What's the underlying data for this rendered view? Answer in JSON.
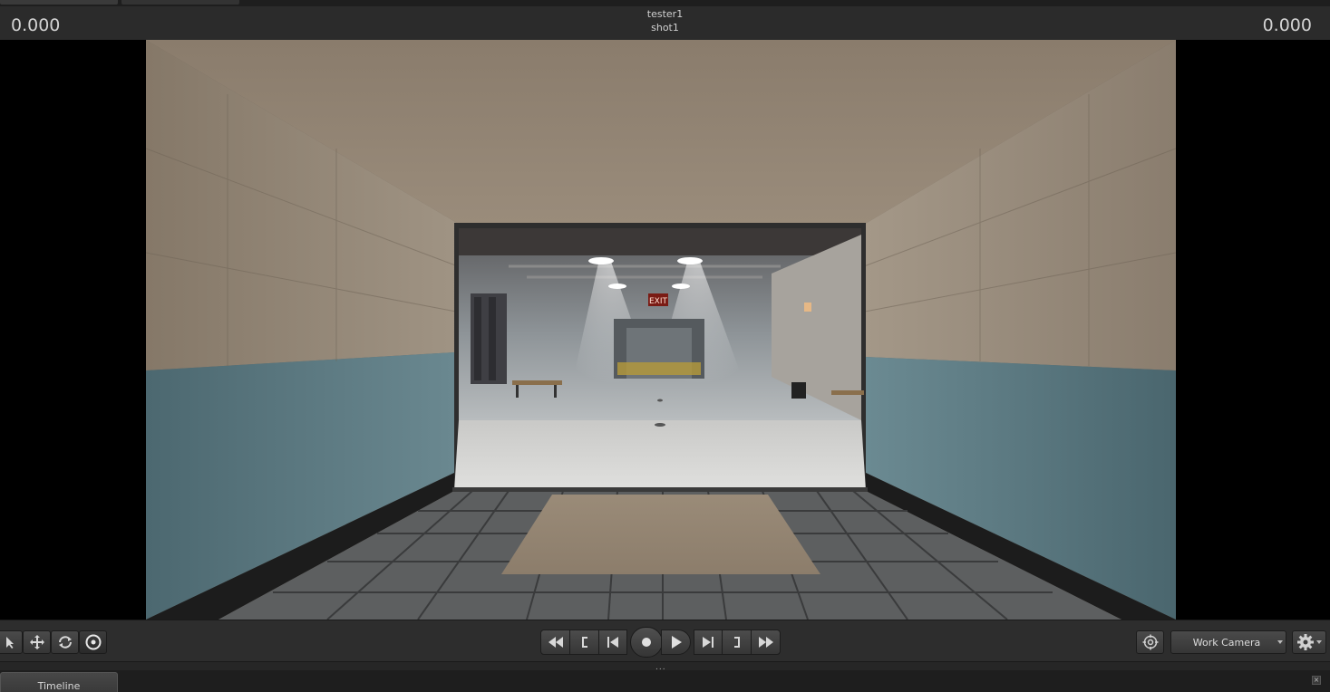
{
  "header": {
    "time_left": "0.000",
    "time_right": "0.000",
    "session_name": "tester1",
    "shot_name": "shot1"
  },
  "viewport": {
    "exit_sign": "EXIT"
  },
  "tools": [
    {
      "icon": "select-arrow-icon"
    },
    {
      "icon": "move-icon"
    },
    {
      "icon": "rotate-icon"
    },
    {
      "icon": "orbit-target-icon",
      "active": true
    }
  ],
  "transport": {
    "buttons": [
      "rewind-icon",
      "mark-in-icon",
      "skip-start-icon",
      "record-icon",
      "play-icon",
      "skip-end-icon",
      "mark-out-icon",
      "fast-forward-icon"
    ]
  },
  "camera": {
    "selected": "Work Camera"
  },
  "panels": {
    "timeline_tab": "Timeline",
    "splitter_handle": "...",
    "close_glyph": "×"
  },
  "colors": {
    "ui_background": "#2d2d2d",
    "viewport_letterbox": "#000000",
    "wall_upper": "#8c7f70",
    "wall_lower": "#4e6a72",
    "ceiling": "#8a7c6c"
  }
}
